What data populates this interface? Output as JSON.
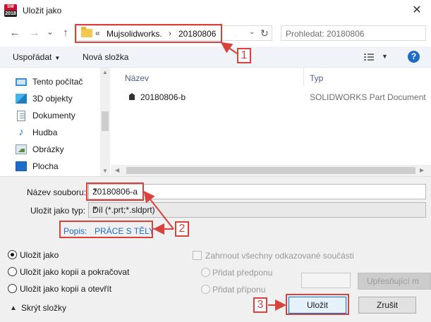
{
  "window": {
    "title": "Uložit jako",
    "app_icon_top": "SW",
    "app_icon_bottom": "2018",
    "close_glyph": "✕"
  },
  "nav": {
    "back_glyph": "←",
    "forward_glyph": "→",
    "recent_glyph": "⌄",
    "up_glyph": "↑",
    "address": {
      "overflow": "«",
      "segments": [
        "Mujsolidworks.",
        "20180806"
      ],
      "separator": "›",
      "dropdown_glyph": "⌄",
      "refresh_glyph": "↻"
    },
    "search_placeholder": "Prohledat: 20180806"
  },
  "toolbar": {
    "organize_label": "Uspořádat",
    "organize_arrow": "▼",
    "new_folder_label": "Nová složka",
    "view_dd_arrow": "▼",
    "help_glyph": "?"
  },
  "sidebar": {
    "items": [
      {
        "label": "Tento počítač",
        "icon": "computer-icon"
      },
      {
        "label": "3D objekty",
        "icon": "3d-objects-icon"
      },
      {
        "label": "Dokumenty",
        "icon": "documents-icon"
      },
      {
        "label": "Hudba",
        "icon": "music-icon"
      },
      {
        "label": "Obrázky",
        "icon": "pictures-icon"
      },
      {
        "label": "Plocha",
        "icon": "desktop-icon"
      }
    ],
    "scroll_up_glyph": "▲",
    "scroll_down_glyph": "▼"
  },
  "filelist": {
    "columns": [
      "Název",
      "Typ"
    ],
    "rows": [
      {
        "name": "20180806-b",
        "type": "SOLIDWORKS Part Document"
      }
    ],
    "scroll_left_glyph": "◀",
    "scroll_right_glyph": "▶"
  },
  "form": {
    "filename_label": "Název souboru:",
    "filename_value": "20180806-a",
    "filetype_label": "Uložit jako typ:",
    "filetype_value": "Díl (*.prt;*.sldprt)",
    "dropdown_glyph": "▼",
    "description_label": "Popis:",
    "description_value": "PRÁCE S TĚLY"
  },
  "options": {
    "save_as": "Uložit jako",
    "save_copy_continue": "Uložit jako kopii a pokračovat",
    "save_copy_open": "Uložit jako kopii a otevřít",
    "include_refs": "Zahrnout všechny odkazované součásti",
    "add_prefix": "Přidat předponu",
    "add_suffix": "Přidat příponu",
    "advanced_button": "Upřesňující m",
    "hide_folders": "Skrýt složky",
    "hide_folders_glyph": "▲"
  },
  "buttons": {
    "save": "Uložit",
    "cancel": "Zrušit"
  },
  "callouts": [
    "1",
    "2",
    "3"
  ],
  "colors": {
    "callout_red": "#d9413d",
    "link_blue": "#1f6cc6",
    "primary_border": "#0078d7"
  }
}
